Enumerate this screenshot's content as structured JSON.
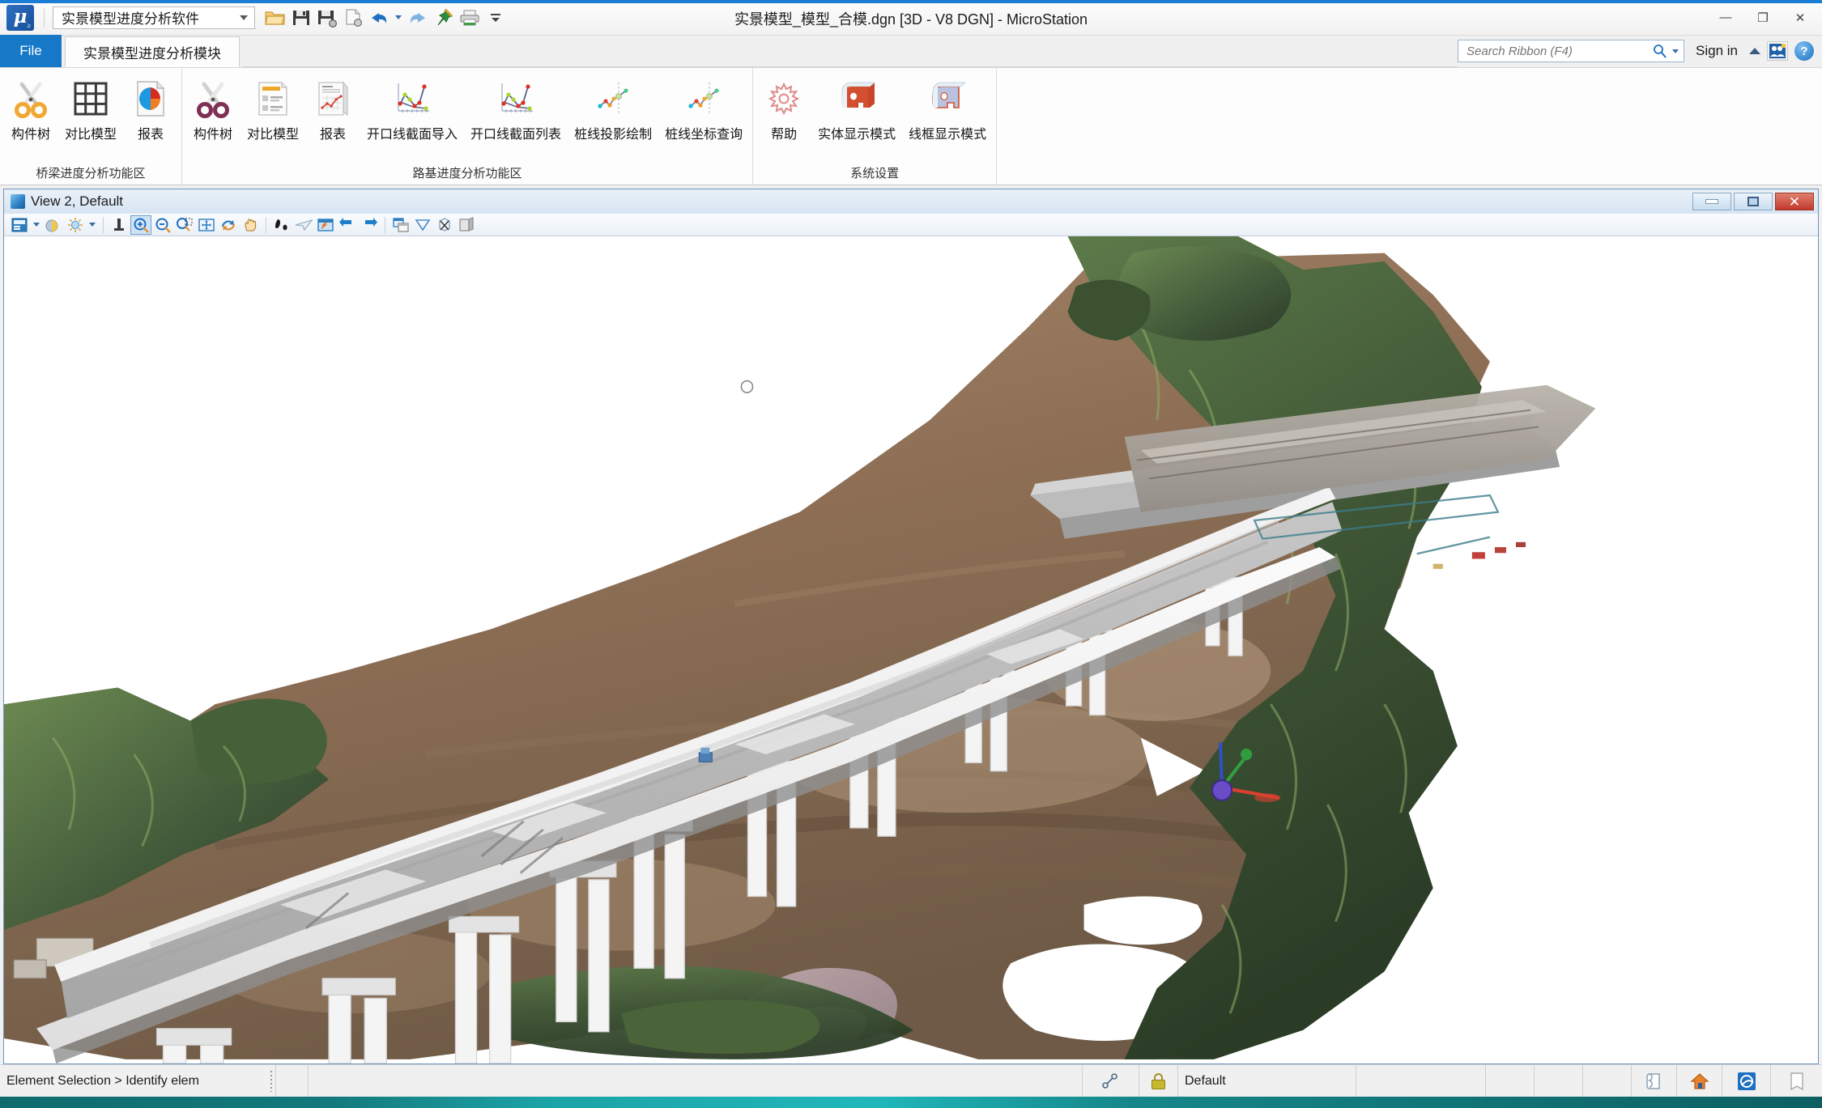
{
  "app": {
    "window_title": "实景模型_模型_合模.dgn [3D - V8 DGN] - MicroStation",
    "product_combo_value": "实景模型进度分析软件"
  },
  "quick_access": {
    "items": [
      {
        "name": "open-icon",
        "tooltip": "Open"
      },
      {
        "name": "save-icon",
        "tooltip": "Save"
      },
      {
        "name": "save-as-icon",
        "tooltip": "Save As"
      },
      {
        "name": "save-settings-icon",
        "tooltip": "Save Settings"
      },
      {
        "name": "undo-icon",
        "tooltip": "Undo"
      },
      {
        "name": "redo-icon",
        "tooltip": "Redo"
      },
      {
        "name": "pin-icon",
        "tooltip": "Pin"
      },
      {
        "name": "print-icon",
        "tooltip": "Print"
      },
      {
        "name": "more-icon",
        "tooltip": "Customize Quick Access Toolbar"
      }
    ]
  },
  "window_controls": {
    "minimize": "—",
    "restore": "❐",
    "close": "✕"
  },
  "tabs": {
    "file_label": "File",
    "items": [
      {
        "label": "实景模型进度分析模块",
        "active": true
      }
    ]
  },
  "search": {
    "placeholder": "Search Ribbon (F4)",
    "value": ""
  },
  "account": {
    "sign_in_label": "Sign in"
  },
  "ribbon": {
    "groups": [
      {
        "title": "桥梁进度分析功能区",
        "buttons": [
          {
            "label": "构件树",
            "icon": "scissors-orange-icon"
          },
          {
            "label": "对比模型",
            "icon": "grid-table-icon"
          },
          {
            "label": "报表",
            "icon": "pie-chart-document-icon"
          }
        ]
      },
      {
        "title": "路基进度分析功能区",
        "buttons": [
          {
            "label": "构件树",
            "icon": "scissors-purple-icon"
          },
          {
            "label": "对比模型",
            "icon": "list-document-icon"
          },
          {
            "label": "报表",
            "icon": "chart-document-icon"
          },
          {
            "label": "开口线截面导入",
            "icon": "line-chart-import-icon"
          },
          {
            "label": "开口线截面列表",
            "icon": "line-chart-list-icon"
          },
          {
            "label": "桩线投影绘制",
            "icon": "polyline-projection-icon"
          },
          {
            "label": "桩线坐标查询",
            "icon": "polyline-coordinate-icon"
          }
        ]
      },
      {
        "title": "系统设置",
        "buttons": [
          {
            "label": "帮助",
            "icon": "gear-icon"
          },
          {
            "label": "实体显示模式",
            "icon": "solid-display-icon"
          },
          {
            "label": "线框显示模式",
            "icon": "wireframe-display-icon"
          }
        ]
      }
    ]
  },
  "view_window": {
    "title": "View 2, Default",
    "toolbar": [
      {
        "name": "view-attributes-icon"
      },
      {
        "name": "view-attributes-caret-icon"
      },
      {
        "name": "display-style-icon"
      },
      {
        "name": "view-brightness-icon"
      },
      {
        "name": "view-brightness-caret-icon"
      },
      {
        "name": "update-view-icon"
      },
      {
        "name": "zoom-in-icon"
      },
      {
        "name": "zoom-out-icon"
      },
      {
        "name": "window-area-icon"
      },
      {
        "name": "fit-view-icon"
      },
      {
        "name": "rotate-view-icon"
      },
      {
        "name": "pan-view-icon"
      },
      {
        "name": "walk-icon"
      },
      {
        "name": "fly-icon"
      },
      {
        "name": "view-next-icon"
      },
      {
        "name": "view-previous-icon"
      },
      {
        "name": "view-forward-icon"
      },
      {
        "name": "copy-view-icon"
      },
      {
        "name": "clip-volume-icon"
      },
      {
        "name": "clip-mask-icon"
      },
      {
        "name": "render-icon"
      }
    ]
  },
  "status_bar": {
    "message": "Element Selection > Identify elem",
    "level_name": "Default",
    "icons": [
      {
        "name": "snap-mode-icon"
      },
      {
        "name": "lock-icon"
      },
      {
        "name": "model-icon"
      },
      {
        "name": "home-icon"
      },
      {
        "name": "task-navigation-icon"
      },
      {
        "name": "element-info-icon"
      }
    ]
  },
  "canvas": {
    "description": "3D reality-mesh view of a viaduct bridge deck on piers over a terrain photogrammetry mesh",
    "colors": {
      "bridge_deck": "#b9b9b9",
      "pier": "#efefef",
      "terrain_rock": "#9a7c63",
      "vegetation": "#4c6140",
      "background": "#ffffff"
    },
    "acs_triad": {
      "x_color": "#d94030",
      "y_color": "#30a040",
      "z_color": "#3050c8"
    }
  }
}
